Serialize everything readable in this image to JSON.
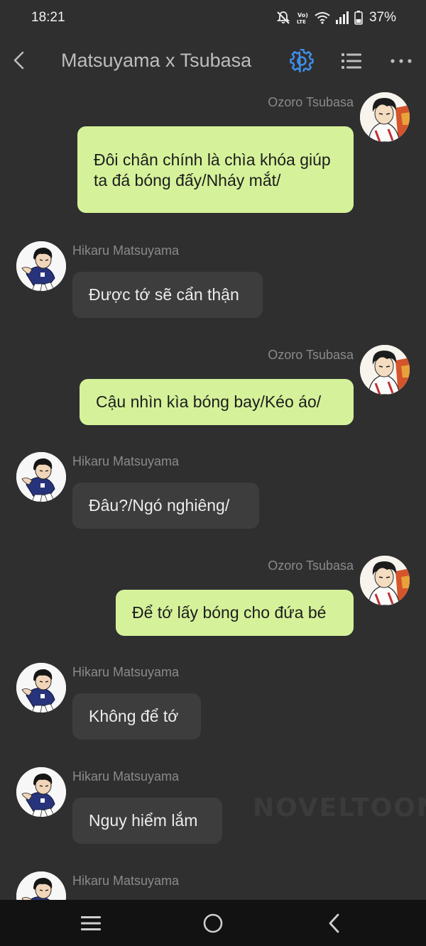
{
  "status_bar": {
    "time": "18:21",
    "battery": "37%",
    "icons": [
      "mute-bell-icon",
      "volte-icon",
      "wifi-icon",
      "signal-icon",
      "battery-icon"
    ]
  },
  "app_bar": {
    "title": "Matsuyama x Tsubasa",
    "icons": [
      "back-icon",
      "settings-icon",
      "chapter-list-icon",
      "more-icon"
    ],
    "accent_color": "#3f8ee8"
  },
  "colors": {
    "background": "#2f2f2f",
    "sent_bubble": "#d5f29a",
    "received_bubble": "#3d3d3d",
    "name_text": "#8a8a8a"
  },
  "messages": [
    {
      "sender": "Ozoro Tsubasa",
      "side": "right",
      "text": "Đôi chân chính là chìa khóa giúp ta đá bóng đấy/Nháy mắt/"
    },
    {
      "sender": "Hikaru Matsuyama",
      "side": "left",
      "text": "Được tớ sẽ cẩn thận"
    },
    {
      "sender": "Ozoro Tsubasa",
      "side": "right",
      "text": "Cậu nhìn kìa bóng bay/Kéo áo/"
    },
    {
      "sender": "Hikaru Matsuyama",
      "side": "left",
      "text": "Đâu?/Ngó nghiêng/"
    },
    {
      "sender": "Ozoro Tsubasa",
      "side": "right",
      "text": "Để tớ lấy bóng cho đứa bé"
    },
    {
      "sender": "Hikaru Matsuyama",
      "side": "left",
      "text": "Không để tớ"
    },
    {
      "sender": "Hikaru Matsuyama",
      "side": "left",
      "text": "Nguy hiểm lắm"
    },
    {
      "sender": "Hikaru Matsuyama",
      "side": "left",
      "text": ""
    }
  ],
  "watermark": "NOVELTOON",
  "nav_bar": {
    "icons": [
      "recent-apps-icon",
      "home-icon",
      "back-nav-icon"
    ]
  }
}
